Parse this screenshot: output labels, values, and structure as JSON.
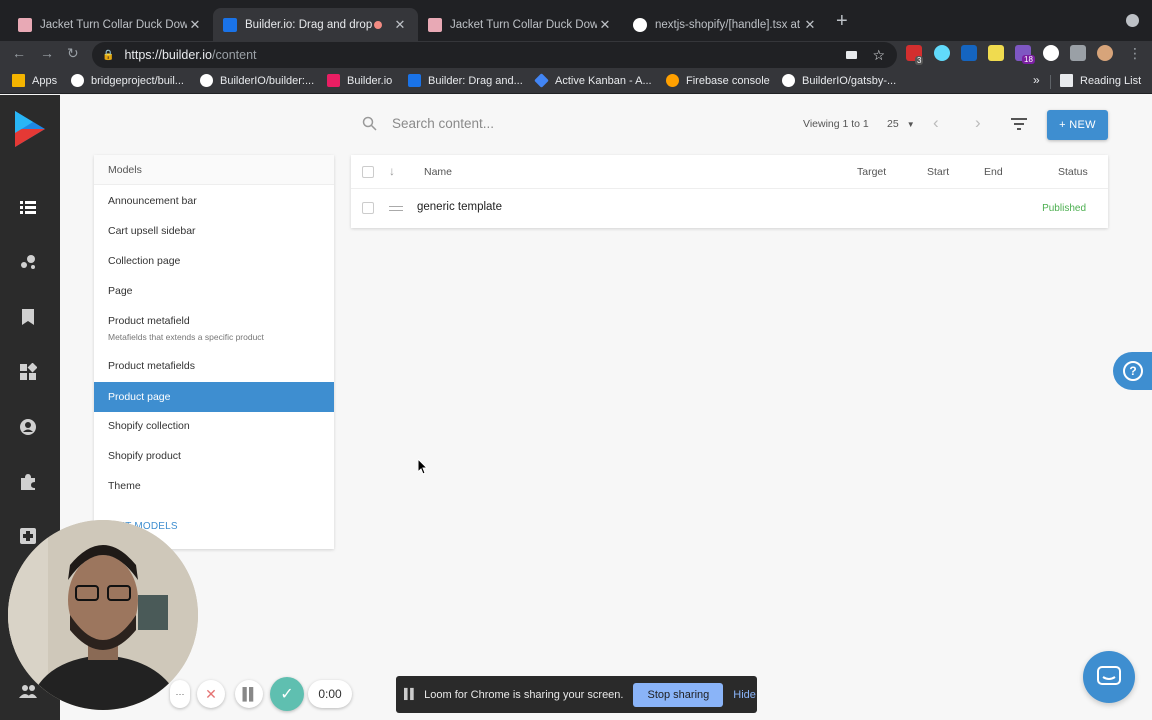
{
  "browser": {
    "tabs": [
      {
        "title": "Jacket Turn Collar Duck Down",
        "favicon_color": "#e8a9b5",
        "active": false
      },
      {
        "title": "Builder.io: Drag and drop p",
        "favicon_color": "#1a73e8",
        "active": true
      },
      {
        "title": "Jacket Turn Collar Duck Down",
        "favicon_color": "#e8a9b5",
        "active": false
      },
      {
        "title": "nextjs-shopify/[handle].tsx at",
        "favicon_color": "#ffffff",
        "active": false
      }
    ],
    "new_tab_label": "+",
    "url_host": "https://builder.io",
    "url_path": "/content",
    "bookmarks": [
      {
        "label": "Apps",
        "color": "#f4b400"
      },
      {
        "label": "bridgeproject/buil...",
        "color": "#ffffff"
      },
      {
        "label": "BuilderIO/builder:...",
        "color": "#ffffff"
      },
      {
        "label": "Builder.io",
        "color": "#e91e63"
      },
      {
        "label": "Builder: Drag and...",
        "color": "#1a73e8"
      },
      {
        "label": "Active Kanban - A...",
        "color": "#4285f4"
      },
      {
        "label": "Firebase console",
        "color": "#ffa000"
      },
      {
        "label": "BuilderIO/gatsby-...",
        "color": "#ffffff"
      }
    ],
    "reading_list": "Reading List",
    "more_bookmarks": "»",
    "extension_badges": [
      "3",
      "18"
    ]
  },
  "sidebar": {
    "icons": [
      "content-icon",
      "insights-icon",
      "bookmark-icon",
      "components-icon",
      "account-icon",
      "extensions-icon",
      "plugin-icon",
      "team-icon"
    ]
  },
  "search": {
    "placeholder": "Search content..."
  },
  "pagination": {
    "viewing": "Viewing 1 to 1",
    "per_page": "25",
    "prev": "‹",
    "next": "›"
  },
  "new_button": "+ NEW",
  "models": {
    "header": "Models",
    "items": [
      {
        "label": "Announcement bar",
        "sub": ""
      },
      {
        "label": "Cart upsell sidebar",
        "sub": ""
      },
      {
        "label": "Collection page",
        "sub": ""
      },
      {
        "label": "Page",
        "sub": ""
      },
      {
        "label": "Product metafield",
        "sub": "Metafields that extends a specific product"
      },
      {
        "label": "Product metafields",
        "sub": ""
      },
      {
        "label": "Product page",
        "sub": "",
        "selected": true
      },
      {
        "label": "Shopify collection",
        "sub": ""
      },
      {
        "label": "Shopify product",
        "sub": ""
      },
      {
        "label": "Theme",
        "sub": ""
      }
    ],
    "edit_link": "EDIT MODELS"
  },
  "table": {
    "columns": [
      "Name",
      "Target",
      "Start",
      "End",
      "Status"
    ],
    "rows": [
      {
        "name": "generic template",
        "target": "",
        "start": "",
        "end": "",
        "status": "Published"
      }
    ]
  },
  "loom": {
    "timer": "0:00",
    "banner_text": "Loom for Chrome is sharing your screen.",
    "stop_label": "Stop sharing",
    "hide_label": "Hide",
    "more_label": "···"
  },
  "colors": {
    "accent": "#3e8ed0",
    "rail": "#2b2b2b",
    "published": "#4caf50"
  }
}
